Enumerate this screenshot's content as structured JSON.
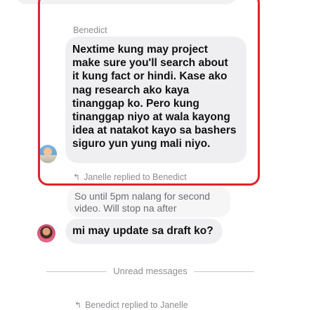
{
  "colors": {
    "bubble": "#efeff1",
    "quoted_bubble": "#f6f6f7",
    "meta_text": "#8e8e93",
    "annotation": "#e0222a"
  },
  "messages": {
    "main": {
      "sender": "Benedict",
      "text": "Nextime kung may project\nmake sure you'll search about\nit kung fact or hindi. Kase ako\nnag research ako kaya\ntinanggap ko. Pero kung\ntinanggap niyo at wala kayong\nidea at natakot kayo sa bashers\nsiguro yun yung mali niyo."
    },
    "reply": {
      "reply_label": "Janelle replied to Benedict",
      "quoted_text": "So until 5pm nalang for second\nvideo. Will stop na after",
      "text": "mi may update sa draft ko?"
    },
    "divider": "Unread messages",
    "next_reply_label": "Benedict replied to Janelle"
  },
  "icons": {
    "reply": "reply-arrow-icon"
  }
}
